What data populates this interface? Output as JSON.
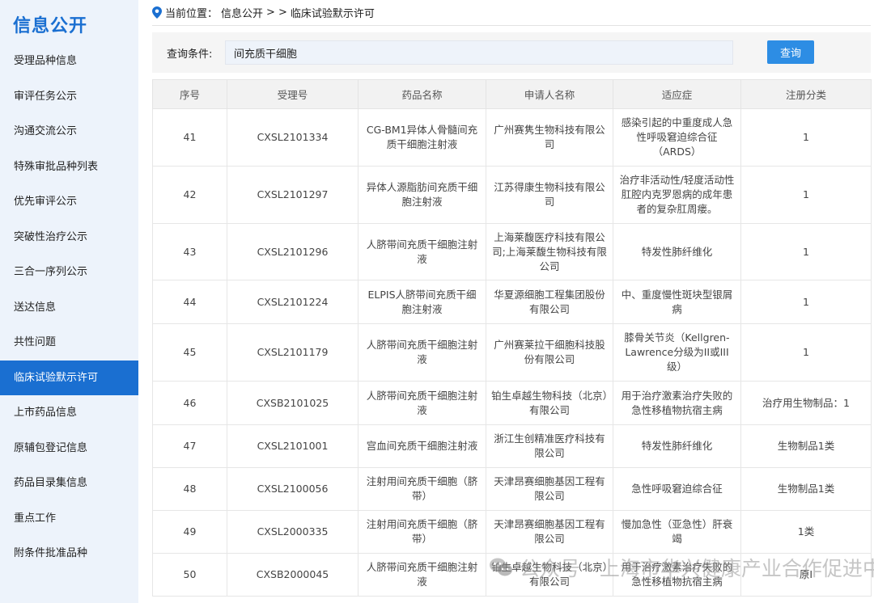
{
  "sidebar": {
    "title": "信息公开",
    "items": [
      {
        "label": "受理品种信息"
      },
      {
        "label": "审评任务公示"
      },
      {
        "label": "沟通交流公示"
      },
      {
        "label": "特殊审批品种列表"
      },
      {
        "label": "优先审评公示"
      },
      {
        "label": "突破性治疗公示"
      },
      {
        "label": "三合一序列公示"
      },
      {
        "label": "送达信息"
      },
      {
        "label": "共性问题"
      },
      {
        "label": "临床试验默示许可",
        "active": true
      },
      {
        "label": "上市药品信息"
      },
      {
        "label": "原辅包登记信息"
      },
      {
        "label": "药品目录集信息"
      },
      {
        "label": "重点工作"
      },
      {
        "label": "附条件批准品种"
      }
    ]
  },
  "breadcrumb": {
    "prefix": "当前位置：",
    "level1": "信息公开",
    "sep1": ">",
    "sep2": ">",
    "level2": "临床试验默示许可"
  },
  "query": {
    "label": "查询条件:",
    "value": "间充质干细胞",
    "button": "查询"
  },
  "table": {
    "headers": [
      "序号",
      "受理号",
      "药品名称",
      "申请人名称",
      "适应症",
      "注册分类"
    ],
    "rows": [
      [
        "41",
        "CXSL2101334",
        "CG-BM1异体人骨髓间充质干细胞注射液",
        "广州赛隽生物科技有限公司",
        "感染引起的中重度成人急性呼吸窘迫综合征（ARDS）",
        "1"
      ],
      [
        "42",
        "CXSL2101297",
        "异体人源脂肪间充质干细胞注射液",
        "江苏得康生物科技有限公司",
        "治疗非活动性/轻度活动性肛腔内克罗恩病的成年患者的复杂肛周瘘。",
        "1"
      ],
      [
        "43",
        "CXSL2101296",
        "人脐带间充质干细胞注射液",
        "上海莱馥医疗科技有限公司;上海莱馥生物科技有限公司",
        "特发性肺纤维化",
        "1"
      ],
      [
        "44",
        "CXSL2101224",
        "ELPIS人脐带间充质干细胞注射液",
        "华夏源细胞工程集团股份有限公司",
        "中、重度慢性斑块型银屑病",
        "1"
      ],
      [
        "45",
        "CXSL2101179",
        "人脐带间充质干细胞注射液",
        "广州赛莱拉干细胞科技股份有限公司",
        "膝骨关节炎（Kellgren-Lawrence分级为II或III级）",
        "1"
      ],
      [
        "46",
        "CXSB2101025",
        "人脐带间充质干细胞注射液",
        "铂生卓越生物科技（北京）有限公司",
        "用于治疗激素治疗失败的急性移植物抗宿主病",
        "治疗用生物制品：1"
      ],
      [
        "47",
        "CXSL2101001",
        "宫血间充质干细胞注射液",
        "浙江生创精准医疗科技有限公司",
        "特发性肺纤维化",
        "生物制品1类"
      ],
      [
        "48",
        "CXSL2100056",
        "注射用间充质干细胞（脐带）",
        "天津昂赛细胞基因工程有限公司",
        "急性呼吸窘迫综合征",
        "生物制品1类"
      ],
      [
        "49",
        "CXSL2000335",
        "注射用间充质干细胞（脐带）",
        "天津昂赛细胞基因工程有限公司",
        "慢加急性（亚急性）肝衰竭",
        "1类"
      ],
      [
        "50",
        "CXSB2000045",
        "人脐带间充质干细胞注射液",
        "铂生卓越生物科技（北京）有限公司",
        "用于治疗激素治疗失败的急性移植物抗宿主病",
        "原I"
      ]
    ]
  },
  "watermark": "公众号 · 上海市华兴健康产业合作促进中心"
}
